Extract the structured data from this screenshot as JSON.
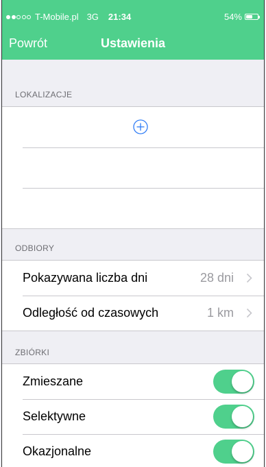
{
  "status_bar": {
    "carrier": "T-Mobile.pl",
    "network": "3G",
    "time": "21:34",
    "battery_percent_label": "54%",
    "battery_level": 0.54,
    "signal_bars_filled": 2,
    "signal_bars_total": 5
  },
  "nav": {
    "back_label": "Powrót",
    "title": "Ustawienia"
  },
  "sections": {
    "locations": {
      "header": "LOKALIZACJE",
      "add_icon": "plus-circle-icon"
    },
    "pickups": {
      "header": "ODBIORY",
      "rows": [
        {
          "label": "Pokazywana liczba dni",
          "value": "28 dni"
        },
        {
          "label": "Odległość od czasowych",
          "value": "1 km"
        }
      ]
    },
    "collections": {
      "header": "ZBIÓRKI",
      "rows": [
        {
          "label": "Zmieszane",
          "enabled": true
        },
        {
          "label": "Selektywne",
          "enabled": true
        },
        {
          "label": "Okazjonalne",
          "enabled": true
        }
      ]
    }
  },
  "colors": {
    "accent": "#4fd08c",
    "link_blue": "#2f7cf6",
    "background": "#efeff4",
    "secondary_text": "#9a9a9f"
  }
}
